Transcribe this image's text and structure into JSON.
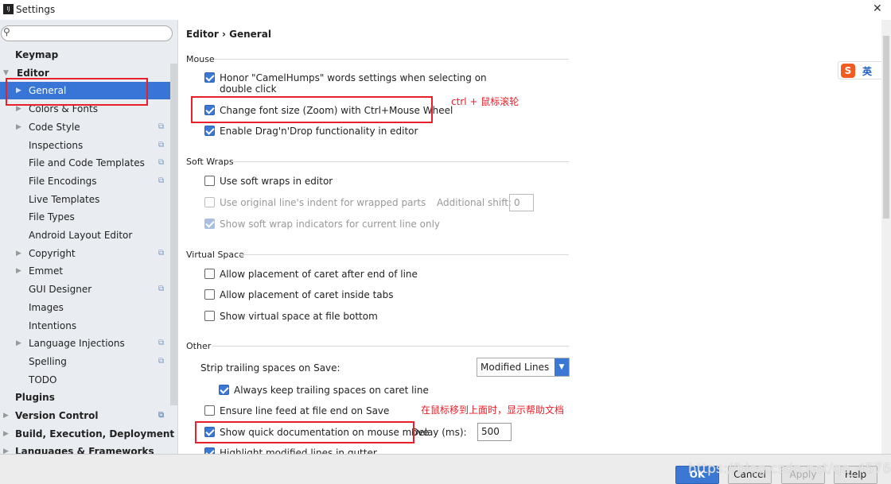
{
  "window": {
    "title": "Settings",
    "close": "✕"
  },
  "search": {
    "placeholder": ""
  },
  "sidebar": {
    "items": [
      {
        "label": "Keymap",
        "bold": true,
        "level": 0,
        "arrow": "",
        "copy": false
      },
      {
        "label": "Editor",
        "bold": true,
        "level": 0,
        "arrow": "▼",
        "copy": false
      },
      {
        "label": "General",
        "level": 1,
        "arrow": "▶",
        "selected": true,
        "copy": false
      },
      {
        "label": "Colors & Fonts",
        "level": 1,
        "arrow": "▶",
        "copy": false
      },
      {
        "label": "Code Style",
        "level": 1,
        "arrow": "▶",
        "copy": true
      },
      {
        "label": "Inspections",
        "level": 1,
        "arrow": "",
        "copy": true
      },
      {
        "label": "File and Code Templates",
        "level": 1,
        "arrow": "",
        "copy": true
      },
      {
        "label": "File Encodings",
        "level": 1,
        "arrow": "",
        "copy": true
      },
      {
        "label": "Live Templates",
        "level": 1,
        "arrow": "",
        "copy": false
      },
      {
        "label": "File Types",
        "level": 1,
        "arrow": "",
        "copy": false
      },
      {
        "label": "Android Layout Editor",
        "level": 1,
        "arrow": "",
        "copy": false
      },
      {
        "label": "Copyright",
        "level": 1,
        "arrow": "▶",
        "copy": true
      },
      {
        "label": "Emmet",
        "level": 1,
        "arrow": "▶",
        "copy": false
      },
      {
        "label": "GUI Designer",
        "level": 1,
        "arrow": "",
        "copy": true
      },
      {
        "label": "Images",
        "level": 1,
        "arrow": "",
        "copy": false
      },
      {
        "label": "Intentions",
        "level": 1,
        "arrow": "",
        "copy": false
      },
      {
        "label": "Language Injections",
        "level": 1,
        "arrow": "▶",
        "copy": true
      },
      {
        "label": "Spelling",
        "level": 1,
        "arrow": "",
        "copy": true
      },
      {
        "label": "TODO",
        "level": 1,
        "arrow": "",
        "copy": false
      },
      {
        "label": "Plugins",
        "bold": true,
        "level": 0,
        "arrow": "",
        "copy": false
      },
      {
        "label": "Version Control",
        "bold": true,
        "level": 0,
        "arrow": "▶",
        "copy": true
      },
      {
        "label": "Build, Execution, Deployment",
        "bold": true,
        "level": 0,
        "arrow": "▶",
        "copy": false
      },
      {
        "label": "Languages & Frameworks",
        "bold": true,
        "level": 0,
        "arrow": "▶",
        "copy": false
      }
    ]
  },
  "breadcrumb": {
    "parent": "Editor",
    "sep": "›",
    "current": "General"
  },
  "sections": {
    "mouse": "Mouse",
    "soft_wraps": "Soft Wraps",
    "virtual_space": "Virtual Space",
    "other": "Other"
  },
  "options": {
    "camel": {
      "label": "Honor \"CamelHumps\" words settings when selecting on",
      "label2": "double click",
      "checked": true
    },
    "zoom": {
      "label": "Change font size (Zoom) with Ctrl+Mouse Wheel",
      "checked": true
    },
    "dnd": {
      "label": "Enable Drag'n'Drop functionality in editor",
      "checked": true
    },
    "softwrap": {
      "label": "Use soft wraps in editor",
      "checked": false
    },
    "indent": {
      "label": "Use original line's indent for wrapped parts",
      "checked": false,
      "disabled": true
    },
    "indicators": {
      "label": "Show soft wrap indicators for current line only",
      "checked": true,
      "disabled": true
    },
    "caret_end": {
      "label": "Allow placement of caret after end of line",
      "checked": false
    },
    "caret_tabs": {
      "label": "Allow placement of caret inside tabs",
      "checked": false
    },
    "virtual_bottom": {
      "label": "Show virtual space at file bottom",
      "checked": false
    },
    "keep_trailing": {
      "label": "Always keep trailing spaces on caret line",
      "checked": true
    },
    "line_feed": {
      "label": "Ensure line feed at file end on Save",
      "checked": false
    },
    "quick_doc": {
      "label": "Show quick documentation on mouse move",
      "checked": true
    },
    "highlight": {
      "label": "Highlight modified lines in gutter",
      "checked": true
    }
  },
  "additional_shift": {
    "label": "Additional shift:",
    "value": "0"
  },
  "strip": {
    "label": "Strip trailing spaces on Save:",
    "value": "Modified Lines"
  },
  "delay": {
    "label": "Delay (ms):",
    "value": "500"
  },
  "annotations": {
    "zoom_note": "ctrl + 鼠标滚轮",
    "doc_note": "在鼠标移到上面时，显示帮助文档"
  },
  "ime": {
    "logo": "S",
    "label": "英"
  },
  "buttons": {
    "ok": "OK",
    "cancel": "Cancel",
    "apply": "Apply",
    "help": "Help"
  },
  "watermark": "https://blog.csdn.net/qq_45765882",
  "colors": {
    "selection": "#3875d7",
    "annotation": "#e8202a",
    "checkbox": "#3a78d4"
  }
}
